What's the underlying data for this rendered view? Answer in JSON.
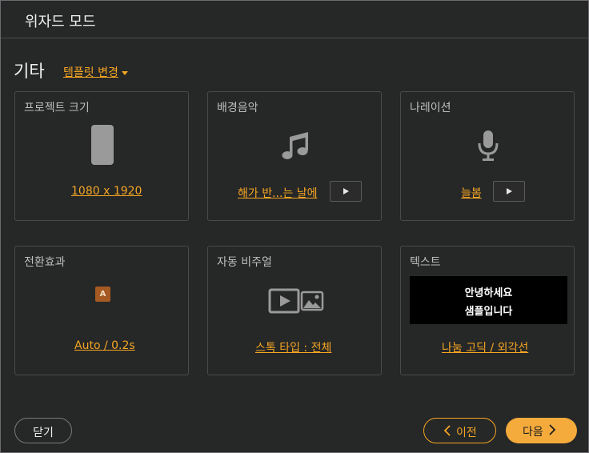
{
  "window": {
    "title": "위자드 모드"
  },
  "section": {
    "title": "기타",
    "template_link": "템플릿 변경"
  },
  "cards": {
    "project_size": {
      "title": "프로젝트 크기",
      "value": "1080 x 1920",
      "icon": "phone-portrait-icon"
    },
    "bgm": {
      "title": "배경음악",
      "value": "해가 반...는 날에",
      "icon": "music-note-icon",
      "play_icon": "play-icon"
    },
    "narration": {
      "title": "나레이션",
      "value": "늘봄",
      "icon": "microphone-icon",
      "play_icon": "play-icon"
    },
    "transition": {
      "title": "전환효과",
      "value": "Auto / 0.2s",
      "icon_letter": "A"
    },
    "auto_visual": {
      "title": "자동 비주얼",
      "value": "스톡 타입 : 전체",
      "icon": "video-image-icon"
    },
    "text": {
      "title": "텍스트",
      "preview_line1": "안녕하세요",
      "preview_line2": "샘플입니다",
      "value": "나눔 고딕 / 외각선"
    }
  },
  "footer": {
    "close_label": "닫기",
    "prev_label": "이전",
    "next_label": "다음"
  },
  "colors": {
    "accent": "#f5a623",
    "background": "#262727",
    "border": "#4a4a4a"
  }
}
